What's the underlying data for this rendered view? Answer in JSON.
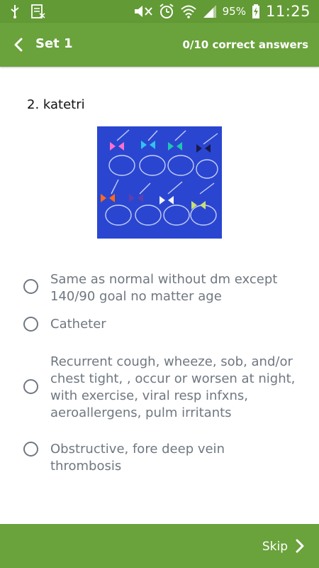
{
  "status_bar": {
    "icons_left": [
      "usb-icon",
      "signal-bars-icon"
    ],
    "icons_right": [
      "mute-icon",
      "alarm-icon",
      "wifi-icon",
      "cell-signal-icon"
    ],
    "battery": "95%",
    "time": "11:25"
  },
  "header": {
    "back_icon": "chevron-left-icon",
    "title": "Set 1",
    "score": "0/10 correct answers"
  },
  "question": {
    "text": "2. katetri"
  },
  "options": [
    {
      "label": "Same as normal without dm except 140/90 goal no matter age"
    },
    {
      "label": "Catheter"
    },
    {
      "label": "Recurrent cough, wheeze, sob, and/or chest tight, , occur or worsen at night, with exercise, viral resp infxns, aeroallergens, pulm irritants"
    },
    {
      "label": "Obstructive, fore deep vein thrombosis"
    }
  ],
  "footer": {
    "skip_label": "Skip",
    "skip_icon": "chevron-right-icon"
  },
  "colors": {
    "header_bg": "#6aa23b",
    "status_bg": "#629a35",
    "option_text": "#6f7780",
    "image_bg": "#2a46d0"
  }
}
